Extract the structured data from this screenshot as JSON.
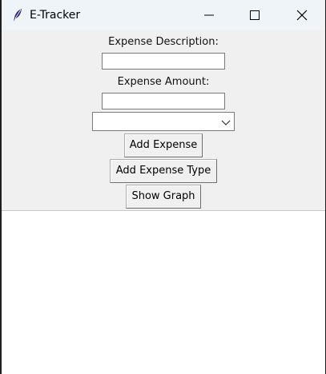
{
  "window": {
    "title": "E-Tracker"
  },
  "form": {
    "description_label": "Expense Description:",
    "description_value": "",
    "amount_label": "Expense Amount:",
    "amount_value": "",
    "type_selected": ""
  },
  "buttons": {
    "add_expense": "Add Expense",
    "add_expense_type": "Add Expense Type",
    "show_graph": "Show Graph"
  },
  "icons": {
    "app": "feather-icon",
    "minimize": "minimize-icon",
    "maximize": "maximize-icon",
    "close": "close-icon",
    "dropdown": "chevron-down-icon"
  }
}
